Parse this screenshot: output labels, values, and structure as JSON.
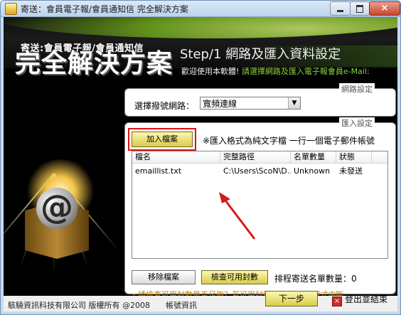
{
  "window": {
    "title": "寄送：會員電子報/會員通知信 完全解決方案",
    "close_glyph": "×"
  },
  "banner": {
    "subtitle": "寄送:會員電子報/會員通知信",
    "main_title": "完全解決方案",
    "step": "Step/1  網路及匯入資料設定",
    "welcome_prefix": "歡迎使用本軟體!",
    "welcome_green": " 請選擇網路及匯入電子報會員e-Mail:"
  },
  "network": {
    "legend": "網路設定",
    "label": "選擇撥號網路：",
    "selected": "寬頻連線",
    "arrow": "▼"
  },
  "import": {
    "legend": "匯入設定",
    "add_button": "加入檔案",
    "hint": "※匯入格式為純文字檔 一行一個電子郵件帳號",
    "columns": [
      "檔名",
      "完整路徑",
      "名單數量",
      "狀態"
    ],
    "rows": [
      {
        "name": "emaillist.txt",
        "path": "C:\\Users\\ScoN\\D...",
        "count": "Unknown",
        "status": "未發送"
      }
    ],
    "remove_button": "移除檔案",
    "check_button": "檢查可用封數",
    "count_text": "排程寄送名單數量：0",
    "warning": "・請檢查可用封數是否足夠？若可用封數為零,將造成程式中斷"
  },
  "footer": {
    "copyright": "駭驍資訊科技有限公司 版權所有 @2008",
    "account": "帳號資訊",
    "next_button": "下一步",
    "exit_label": "登出並結束",
    "exit_glyph": "×"
  },
  "colors": {
    "accent_green": "#8cd43e",
    "highlight_red": "#e01010",
    "warning_orange": "#c08000"
  }
}
